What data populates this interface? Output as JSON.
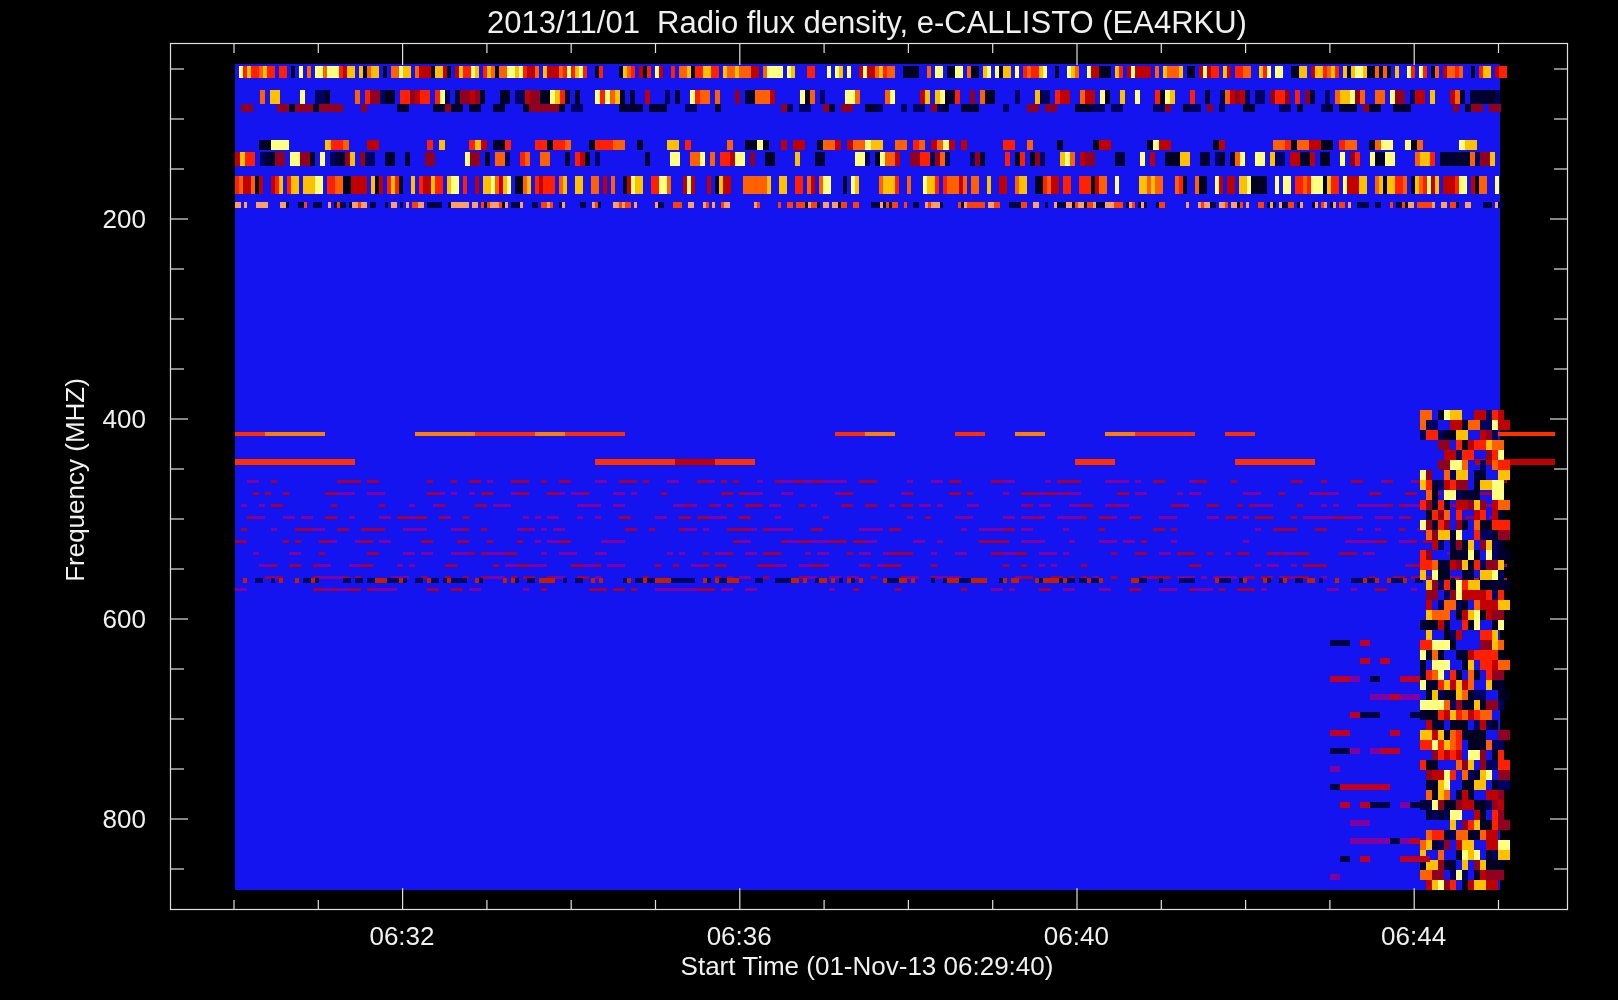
{
  "title": "2013/11/01  Radio flux density, e-CALLISTO (EA4RKU)",
  "plot": {
    "ylabel": "Frequency (MHZ)",
    "xlabel": "Start Time (01-Nov-13 06:29:40)",
    "yticks": [
      "200",
      "400",
      "600",
      "800"
    ],
    "xticks": [
      "06:32",
      "06:36",
      "06:40",
      "06:44"
    ]
  }
}
